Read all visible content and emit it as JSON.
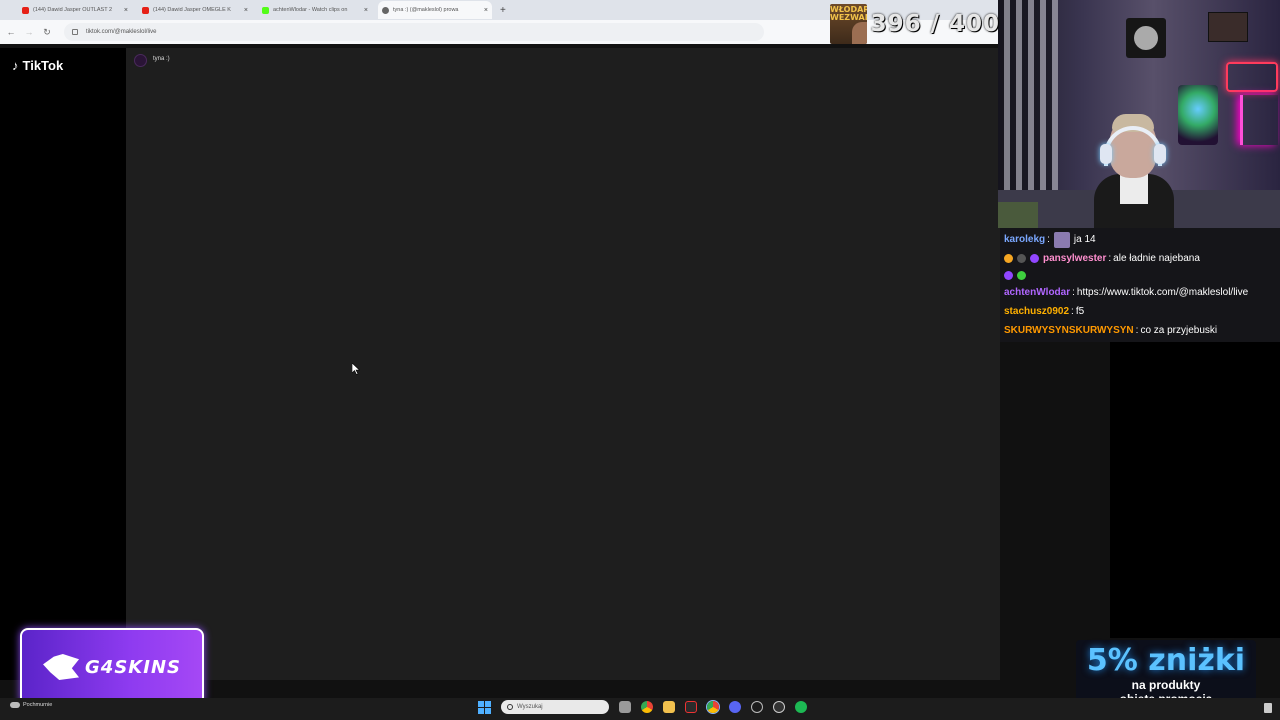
{
  "browser": {
    "tabs": [
      {
        "title": "(144) Dawid Jasper OUTLAST 2",
        "icon": "youtube-icon",
        "active": false
      },
      {
        "title": "(144) Dawid Jasper OMEGLE K",
        "icon": "youtube-icon",
        "active": false
      },
      {
        "title": "achtenWlodar - Watch clips on",
        "icon": "kick-icon",
        "active": false
      },
      {
        "title": "tyna :) (@makleslol) prowa",
        "icon": "tiktok-icon",
        "active": true
      }
    ],
    "new_tab": "+",
    "close_glyph": "×",
    "url": "tiktok.com/@makleslol/live"
  },
  "tiktok": {
    "logo": "TikTok",
    "host_name": "tyna :)"
  },
  "goal": {
    "image_text": "WŁODARY WEZWANIA",
    "count": "396 / 400"
  },
  "chat": {
    "messages": [
      {
        "user": "karolekg",
        "user_color": "#7aa7ff",
        "text": " ja 14",
        "emote": true,
        "badges": []
      },
      {
        "user": "pansylwester",
        "user_color": "#ff8fcf",
        "text": " ale ładnie najebana",
        "emote": false,
        "badges": [
          "b1",
          "b2",
          "b3"
        ]
      },
      {
        "user": "",
        "user_color": "#fff",
        "text": "",
        "emote": false,
        "badges": [
          "b4",
          "b5"
        ]
      },
      {
        "user": "achtenWlodar",
        "user_color": "#b066ff",
        "text": " https://www.tiktok.com/@makleslol/live",
        "emote": false,
        "badges": []
      },
      {
        "user": "stachusz0902",
        "user_color": "#ffb000",
        "text": " f5",
        "emote": false,
        "badges": []
      },
      {
        "user": "SKURWYSYNSKURWYSYN",
        "user_color": "#ff9900",
        "text": " co za przyjebuski",
        "emote": false,
        "badges": []
      }
    ]
  },
  "promo": {
    "headline": "5% zniżki",
    "line1": "na produkty",
    "line2": "objęte promocją"
  },
  "sponsor": {
    "name": "G4SKINS"
  },
  "taskbar": {
    "weather": "Pochmurnie",
    "search_placeholder": "Wyszukaj"
  }
}
